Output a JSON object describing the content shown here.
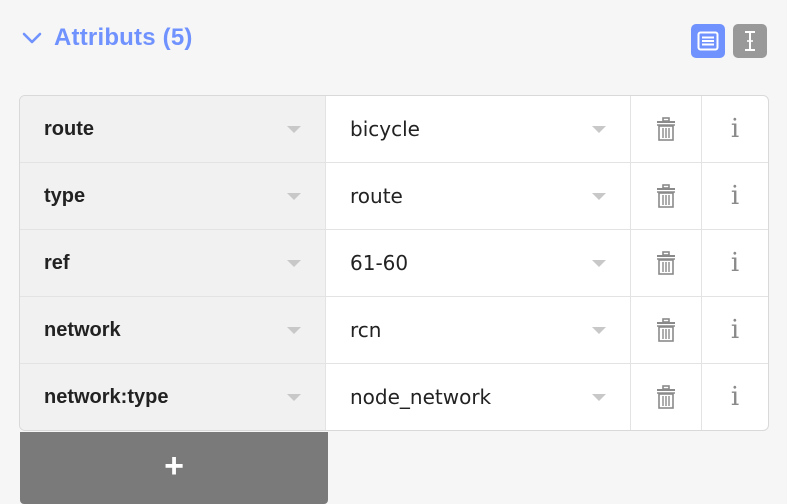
{
  "section": {
    "title": "Attributs (5)",
    "toggle_icon": "chevron-down-icon",
    "accent_color": "#7092fe"
  },
  "view_buttons": [
    {
      "icon": "list-view-icon",
      "active": true
    },
    {
      "icon": "text-view-icon",
      "active": false
    }
  ],
  "tags": [
    {
      "key": "route",
      "value": "bicycle"
    },
    {
      "key": "type",
      "value": "route"
    },
    {
      "key": "ref",
      "value": "61-60"
    },
    {
      "key": "network",
      "value": "rcn"
    },
    {
      "key": "network:type",
      "value": "node_network"
    }
  ],
  "row_actions": {
    "delete_icon": "trash-icon",
    "info_label": "i"
  },
  "add_button": {
    "label": "+"
  }
}
